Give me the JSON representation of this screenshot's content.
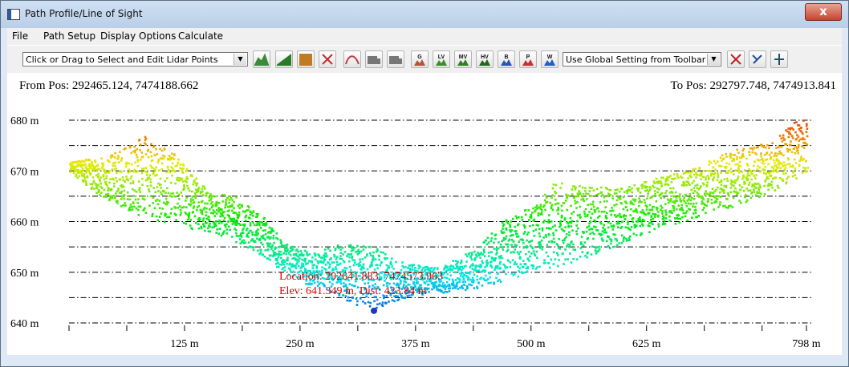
{
  "window": {
    "title": "Path Profile/Line of Sight",
    "close_label": "x"
  },
  "menu": [
    "File",
    "Path Setup",
    "Display Options",
    "Calculate"
  ],
  "toolbar": {
    "mode_select": "Click or Drag to Select and Edit Lidar Points",
    "setting_select": "Use Global Setting from Toolbar",
    "icons": [
      "profile-icon",
      "terrain-icon",
      "grid-icon",
      "tools-icon",
      "chart-icon",
      "truck-icon",
      "truck-forward-icon",
      "ground-class-icon",
      "low-vegetation-icon",
      "medium-vegetation-icon",
      "high-vegetation-icon",
      "building-icon",
      "power-line-icon",
      "water-icon",
      "delete-points-icon",
      "settings-icon",
      "classify-icon"
    ],
    "icon_labels": [
      "",
      "",
      "",
      "",
      "",
      "",
      "",
      "G",
      "LV",
      "MV",
      "HV",
      "B",
      "P",
      "W",
      "",
      "",
      ""
    ]
  },
  "profile": {
    "from_pos": "From Pos: 292465.124, 7474188.662",
    "to_pos": "To Pos: 292797.748, 7474913.841",
    "cursor_location": "Location: 292641.883, 7474573.963",
    "cursor_elev": "Elev: 641.349 m, Dist: 423.84 m"
  },
  "chart_data": {
    "type": "scatter",
    "title": "",
    "xlabel": "",
    "ylabel": "",
    "xlim": [
      0,
      805
    ],
    "ylim": [
      639,
      682
    ],
    "y_ticks": [
      "680 m",
      "670 m",
      "660 m",
      "650 m",
      "640 m"
    ],
    "y_tick_values": [
      680,
      670,
      660,
      650,
      640
    ],
    "x_ticks": [
      "125 m",
      "250 m",
      "375 m",
      "500 m",
      "625 m",
      "798 m"
    ],
    "x_tick_values": [
      125,
      250,
      375,
      500,
      625,
      798
    ],
    "gridlines": "dash-dot every 5 m",
    "color_scale": "elevation (blue low, red high)",
    "profile_lower_envelope": [
      [
        0,
        670
      ],
      [
        40,
        664
      ],
      [
        80,
        661
      ],
      [
        125,
        659
      ],
      [
        170,
        657
      ],
      [
        210,
        653
      ],
      [
        250,
        648
      ],
      [
        285,
        646
      ],
      [
        310,
        643.5
      ],
      [
        330,
        643
      ],
      [
        360,
        645
      ],
      [
        400,
        646
      ],
      [
        440,
        647
      ],
      [
        480,
        649
      ],
      [
        520,
        651
      ],
      [
        560,
        653
      ],
      [
        600,
        656
      ],
      [
        640,
        659
      ],
      [
        680,
        661
      ],
      [
        720,
        663
      ],
      [
        760,
        666
      ],
      [
        798,
        670
      ]
    ],
    "profile_upper_envelope": [
      [
        0,
        672
      ],
      [
        40,
        673
      ],
      [
        80,
        677
      ],
      [
        110,
        674
      ],
      [
        150,
        666
      ],
      [
        180,
        665
      ],
      [
        210,
        661
      ],
      [
        230,
        656
      ],
      [
        260,
        654
      ],
      [
        300,
        656
      ],
      [
        330,
        655
      ],
      [
        360,
        652
      ],
      [
        400,
        651
      ],
      [
        440,
        655
      ],
      [
        470,
        661
      ],
      [
        500,
        663
      ],
      [
        525,
        668
      ],
      [
        560,
        667
      ],
      [
        600,
        667
      ],
      [
        640,
        669
      ],
      [
        680,
        671
      ],
      [
        700,
        673
      ],
      [
        730,
        675
      ],
      [
        760,
        676
      ],
      [
        790,
        681
      ],
      [
        798,
        680
      ]
    ]
  }
}
